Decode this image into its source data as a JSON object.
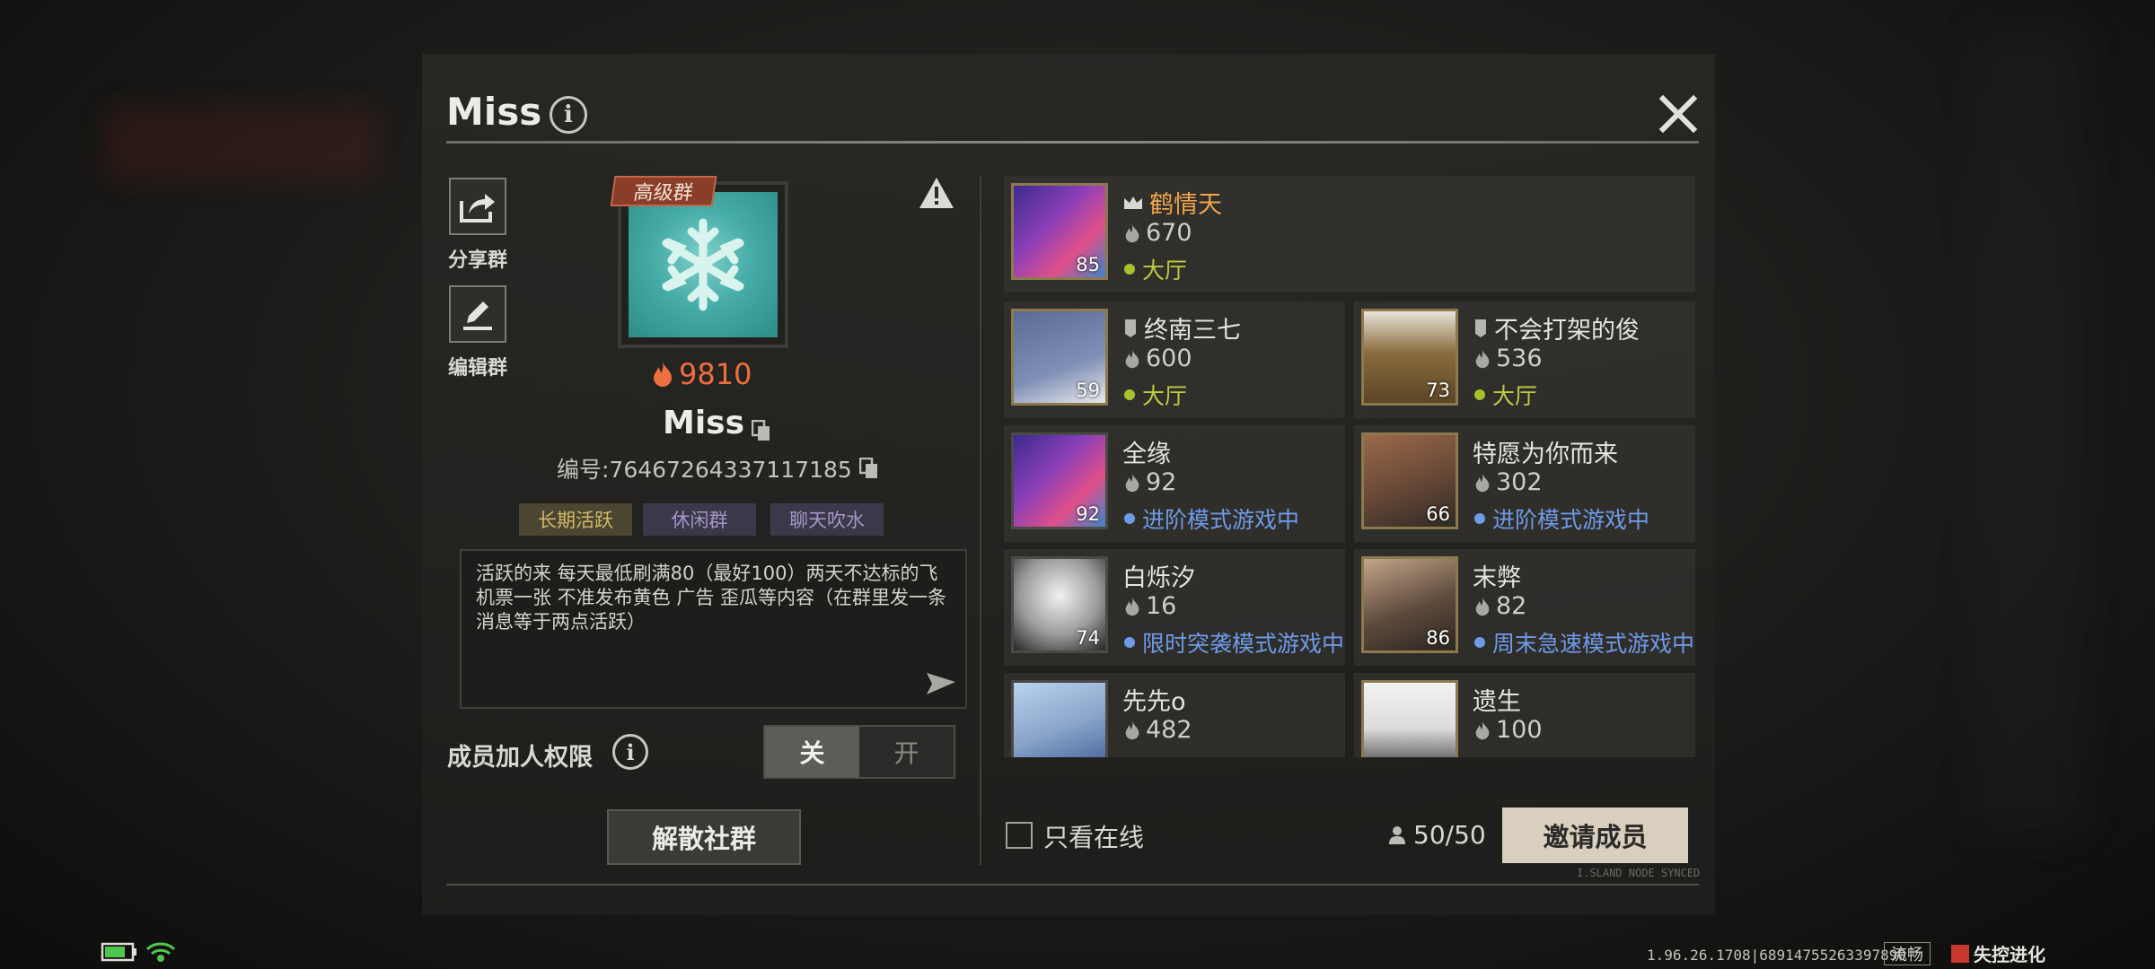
{
  "header": {
    "title": "Miss"
  },
  "side_actions": {
    "share_label": "分享群",
    "edit_label": "编辑群"
  },
  "group": {
    "tier_badge": "高级群",
    "heat": "9810",
    "name": "Miss",
    "id_text": "编号:7646726433711718­5",
    "tags": [
      "长期活跃",
      "休闲群",
      "聊天吹水"
    ],
    "description": "活跃的来 每天最低刷满80（最好100）两天不达标的飞机票一张 不准发布黄色 广告 歪瓜等内容（在群里发一条消息等于两点活跃）"
  },
  "permission": {
    "label": "成员加人权限",
    "off_label": "关",
    "on_label": "开",
    "selected": "关"
  },
  "disband_label": "解散社群",
  "members": [
    {
      "name": "鹤情天",
      "heat": "670",
      "status": "大厅",
      "level": "85",
      "role": "owner",
      "status_type": "hall",
      "avatar_color": "#5b3fa8"
    },
    {
      "name": "终南三七",
      "heat": "600",
      "status": "大厅",
      "level": "59",
      "role": "admin",
      "status_type": "hall",
      "avatar_color": "#6c7aa3"
    },
    {
      "name": "不会打架的俊",
      "heat": "536",
      "status": "大厅",
      "level": "73",
      "role": "admin",
      "status_type": "hall",
      "avatar_color": "#8a6d3f"
    },
    {
      "name": "全缘",
      "heat": "92",
      "status": "进阶模式游戏中",
      "level": "92",
      "role": "member",
      "status_type": "game",
      "avatar_color": "#5b3fa8"
    },
    {
      "name": "特愿为你而来",
      "heat": "302",
      "status": "进阶模式游戏中",
      "level": "66",
      "role": "member",
      "status_type": "game",
      "avatar_color": "#6b4a38"
    },
    {
      "name": "白烁汐",
      "heat": "16",
      "status": "限时突袭模式游戏中",
      "level": "74",
      "role": "member",
      "status_type": "game",
      "avatar_color": "#d9d9d9"
    },
    {
      "name": "末弊",
      "heat": "82",
      "status": "周末急速模式游戏中",
      "level": "86",
      "role": "member",
      "status_type": "game",
      "avatar_color": "#5e4a3c"
    },
    {
      "name": "先先o",
      "heat": "482",
      "status": "",
      "level": "",
      "role": "member",
      "status_type": "",
      "avatar_color": "#8aa5c9"
    },
    {
      "name": "遗生",
      "heat": "100",
      "status": "",
      "level": "",
      "role": "member",
      "status_type": "",
      "avatar_color": "#dcdcdc"
    }
  ],
  "footer_bar": {
    "online_only_label": "只看在线",
    "member_count": "50/50",
    "invite_label": "邀请成员",
    "synced_text": "I.SLAND NODE SYNCED"
  },
  "status_bar": {
    "build": "1.96.26.1708|68914755263397890",
    "smooth": "流畅",
    "brand": "失控进化"
  },
  "colors": {
    "heat": "#ef6e3d",
    "hall": "#a6c12e",
    "in_game": "#6f9ae6",
    "owner_name": "#f0a64c"
  }
}
